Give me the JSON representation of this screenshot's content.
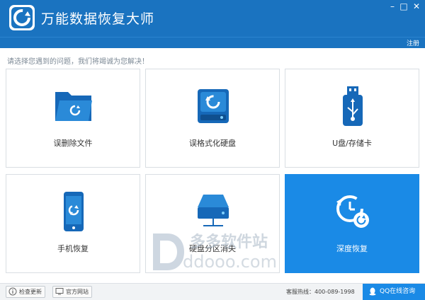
{
  "window": {
    "title": "万能数据恢复大师",
    "min_label": "–",
    "max_label": "□",
    "close_label": "✕"
  },
  "menubar": {
    "register_label": "注册"
  },
  "prompt": "请选择您遇到的问题，我们将竭诚为您解决！",
  "cards": [
    {
      "label": "误删除文件",
      "icon": "folder-refresh-icon"
    },
    {
      "label": "误格式化硬盘",
      "icon": "hard-disk-icon"
    },
    {
      "label": "U盘/存储卡",
      "icon": "usb-drive-icon"
    },
    {
      "label": "手机恢复",
      "icon": "mobile-phone-icon"
    },
    {
      "label": "硬盘分区消失",
      "icon": "partition-disk-icon"
    },
    {
      "label": "深度恢复",
      "icon": "deep-recovery-clock-icon"
    }
  ],
  "watermark": {
    "brand": "多多软件站",
    "domain": "ddooo.com"
  },
  "footer": {
    "check_update_label": "检查更新",
    "official_site_label": "官方网站",
    "hotline": "客服热线：400-089-1998",
    "qq_label": "QQ在线咨询"
  },
  "colors": {
    "primary": "#1a73c0",
    "accent": "#1a8ae6",
    "icon_blue": "#1668b8"
  }
}
